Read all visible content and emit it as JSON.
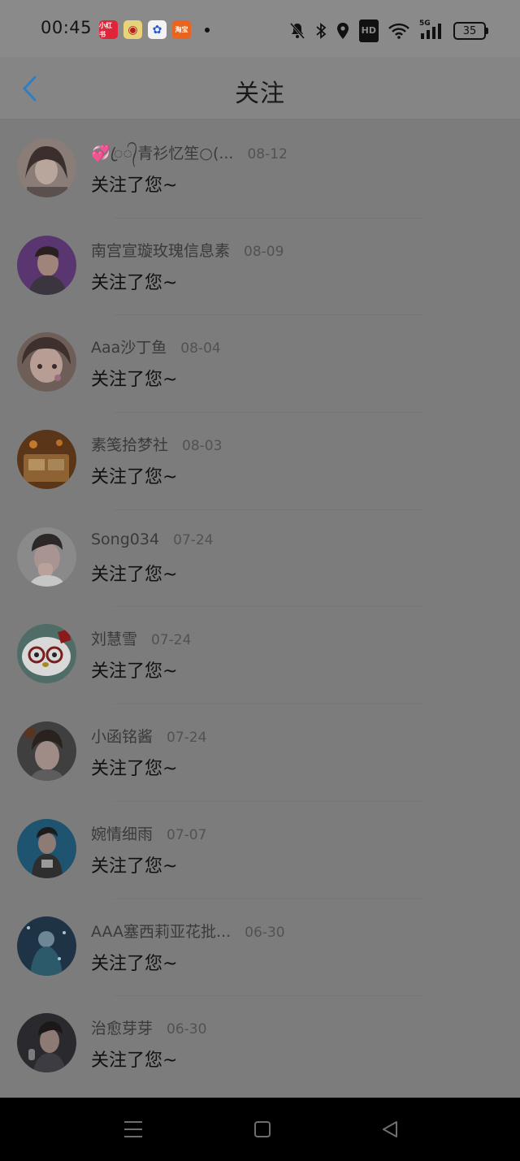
{
  "status_bar": {
    "time": "00:45",
    "app_icons": [
      {
        "name": "xiaohongshu",
        "label": "小红书"
      },
      {
        "name": "weibo",
        "label": "◉"
      },
      {
        "name": "baidu",
        "label": "✿"
      },
      {
        "name": "taobao",
        "label": "淘宝"
      }
    ],
    "network_label": "HD",
    "signal_label": "5G",
    "battery": "35"
  },
  "header": {
    "title": "关注",
    "back_icon": "chevron-left-icon",
    "accent_color": "#2f7fc4"
  },
  "notifications": [
    {
      "name": "💞ꦿ᭄青衫忆笙○(...",
      "date": "08-12",
      "message": "关注了您~"
    },
    {
      "name": "南宫宣璇玫瑰信息素",
      "date": "08-09",
      "message": "关注了您~"
    },
    {
      "name": "Aaa沙丁鱼",
      "date": "08-04",
      "message": "关注了您~"
    },
    {
      "name": "素笺拾梦社",
      "date": "08-03",
      "message": "关注了您~"
    },
    {
      "name": "Song034",
      "date": "07-24",
      "message": "关注了您~"
    },
    {
      "name": "刘慧雪",
      "date": "07-24",
      "message": "关注了您~"
    },
    {
      "name": "小函铭酱",
      "date": "07-24",
      "message": "关注了您~"
    },
    {
      "name": "婉情细雨",
      "date": "07-07",
      "message": "关注了您~"
    },
    {
      "name": "AAA塞西莉亚花批...",
      "date": "06-30",
      "message": "关注了您~"
    },
    {
      "name": "治愈芽芽",
      "date": "06-30",
      "message": "关注了您~"
    }
  ],
  "nav_bar": {
    "buttons": [
      "menu-icon",
      "home-icon",
      "back-triangle-icon"
    ]
  }
}
